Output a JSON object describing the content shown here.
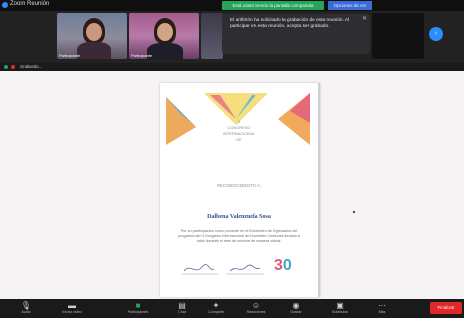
{
  "window": {
    "title": "Zoom Reunión"
  },
  "recording_banner": {
    "text": "Está usted viendo la pantalla compartida",
    "options_label": "Opciones de ver"
  },
  "participants": [
    {
      "name": "Participante"
    },
    {
      "name": "Participante"
    },
    {
      "name": ""
    }
  ],
  "notification": {
    "text": "El anfitrión ha solicitado la grabación de esta reunión. Al participar en esta reunión, acepta ser grabado."
  },
  "self_tile": {
    "name": ""
  },
  "subbar": {
    "label": "Grabando...",
    "right_text": ""
  },
  "certificate": {
    "header_line1": "II",
    "header_line2": "CONGRESO",
    "header_line3": "INTERNACIONAL",
    "header_line4": "DE",
    "header_line5": "",
    "award_label": "RECONOCIMIENTO A:",
    "recipient": "Dalbena Valenzuela Sosa",
    "paragraph": "Por su participación como ponente en el Encuentro de Egresados del programa del II Congreso Internacional de Docentes Comunes llevado a cabo durante el mes de octubre de manera virtual."
  },
  "toolbar": {
    "items": [
      {
        "label": "Audio",
        "icon": "microphone-icon"
      },
      {
        "label": "Iniciar video",
        "icon": "video-camera-icon"
      },
      {
        "label": "Participantes",
        "icon": "participants-icon"
      },
      {
        "label": "Chat",
        "icon": "chat-icon"
      },
      {
        "label": "Compartir",
        "icon": "share-screen-icon"
      },
      {
        "label": "Reacciones",
        "icon": "reactions-icon"
      },
      {
        "label": "Grabar",
        "icon": "record-icon"
      },
      {
        "label": "Subtítulos",
        "icon": "captions-icon"
      },
      {
        "label": "Más",
        "icon": "more-icon"
      }
    ],
    "end_label": "Finalizar"
  },
  "colors": {
    "accent_blue": "#2d8cff",
    "record_green": "#27a35a",
    "end_red": "#e02828"
  }
}
